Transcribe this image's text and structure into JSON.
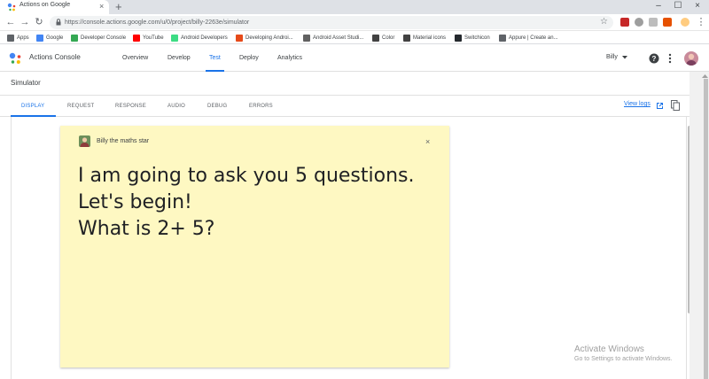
{
  "browser": {
    "tab_title": "Actions on Google",
    "tab_close": "×",
    "new_tab": "+",
    "url": "https://console.actions.google.com/u/0/project/billy-2263e/simulator",
    "window_controls": [
      "–",
      "☐",
      "×"
    ],
    "bookmarks": [
      {
        "label": "Apps",
        "color": "#5f6368"
      },
      {
        "label": "Google",
        "color": "#4285f4"
      },
      {
        "label": "Developer Console",
        "color": "#34a853"
      },
      {
        "label": "YouTube",
        "color": "#ff0000"
      },
      {
        "label": "Android Developers",
        "color": "#3ddc84"
      },
      {
        "label": "Developing Androi...",
        "color": "#e64a19"
      },
      {
        "label": "Android Asset Studi...",
        "color": "#616161"
      },
      {
        "label": "Color",
        "color": "#424242"
      },
      {
        "label": "Material icons",
        "color": "#424242"
      },
      {
        "label": "Switchicon",
        "color": "#24292e"
      },
      {
        "label": "Appure | Create an...",
        "color": "#5f6368"
      }
    ]
  },
  "app": {
    "brand": "Actions Console",
    "nav": [
      "Overview",
      "Develop",
      "Test",
      "Deploy",
      "Analytics"
    ],
    "active_nav": "Test",
    "user": "Billy",
    "accent_color": "#1a73e8"
  },
  "simulator": {
    "title": "Simulator",
    "tabs": [
      "DISPLAY",
      "REQUEST",
      "RESPONSE",
      "AUDIO",
      "DEBUG",
      "ERRORS"
    ],
    "active_tab": "DISPLAY",
    "view_logs": "View logs"
  },
  "card": {
    "name": "Billy the maths star",
    "close": "×",
    "text": "I am going to ask you 5 questions. Let's begin!\nWhat is 2+ 5?",
    "background": "#fef8c2"
  },
  "watermark": {
    "line1": "Activate Windows",
    "line2": "Go to Settings to activate Windows."
  }
}
